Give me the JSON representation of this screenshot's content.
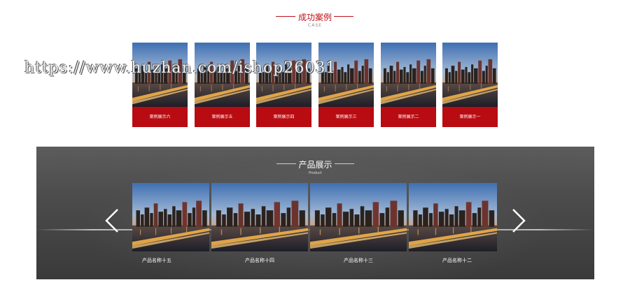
{
  "case_section": {
    "title": "成功案例",
    "subtitle": "CASE",
    "items": [
      {
        "label": "案例展示六"
      },
      {
        "label": "案例展示五"
      },
      {
        "label": "案例展示四"
      },
      {
        "label": "案例展示三"
      },
      {
        "label": "案例展示二"
      },
      {
        "label": "案例展示一"
      }
    ]
  },
  "watermark": "https://www.huzhan.com/ishop26031",
  "product_section": {
    "title": "产品展示",
    "subtitle": "Product",
    "items": [
      {
        "label": "产品名称十五"
      },
      {
        "label": "产品名称十四"
      },
      {
        "label": "产品名称十三"
      },
      {
        "label": "产品名称十二"
      }
    ],
    "prev_icon": "chevron-left-icon",
    "next_icon": "chevron-right-icon"
  },
  "colors": {
    "accent": "#c0121a",
    "case_caption_bg": "#b80b12",
    "product_band": "#4b4b4b"
  }
}
